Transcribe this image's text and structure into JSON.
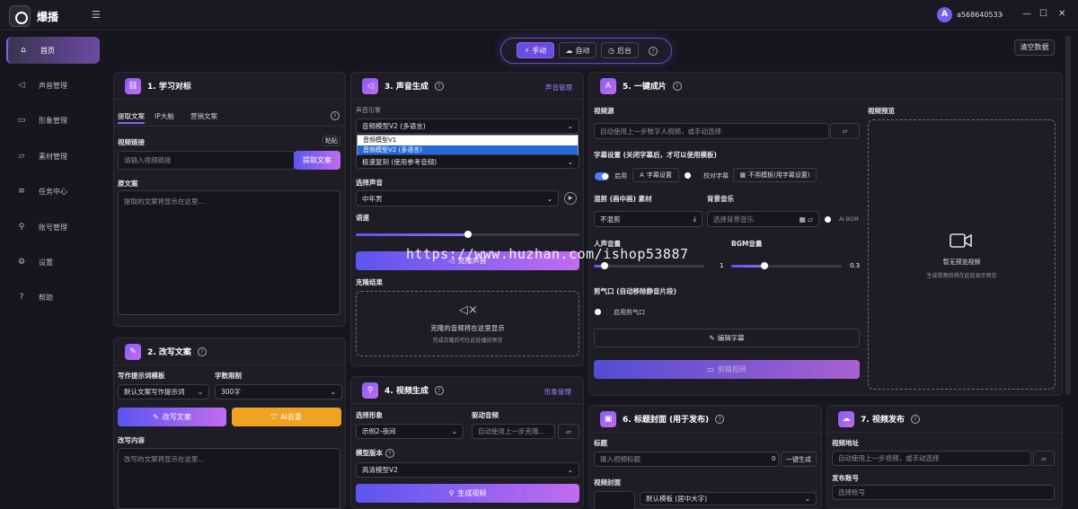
{
  "app": {
    "name": "爆播",
    "user": "a568640533",
    "avatar_letter": "A"
  },
  "window": {
    "min": "—",
    "max": "☐",
    "close": "✕"
  },
  "sidebar": {
    "items": [
      {
        "label": "首页",
        "icon": "home-icon"
      },
      {
        "label": "声音管理",
        "icon": "speaker-icon"
      },
      {
        "label": "形象管理",
        "icon": "video-icon"
      },
      {
        "label": "素材管理",
        "icon": "folder-icon"
      },
      {
        "label": "任务中心",
        "icon": "list-icon"
      },
      {
        "label": "账号管理",
        "icon": "user-icon"
      },
      {
        "label": "设置",
        "icon": "gear-icon"
      },
      {
        "label": "帮助",
        "icon": "help-icon"
      }
    ]
  },
  "modes": {
    "manual": "手动",
    "auto": "自动",
    "background": "后台"
  },
  "clear_button": "清空数据",
  "p1": {
    "title": "1. 学习对标",
    "tabs": [
      "提取文案",
      "IP大脑",
      "营销文案"
    ],
    "video_link_label": "视频链接",
    "paste": "粘贴",
    "link_placeholder": "请输入视频链接",
    "extract_button": "提取文案",
    "source_label": "原文案",
    "source_placeholder": "提取的文案将显示在这里..."
  },
  "p2": {
    "title": "2. 改写文案",
    "template_label": "写作提示词模板",
    "template_value": "默认文案写作提示词",
    "limit_label": "字数限制",
    "limit_value": "300字",
    "rewrite_button": "改写文案",
    "ai_button": "AI去重",
    "content_label": "改写内容",
    "content_placeholder": "改写的文案将显示在这里..."
  },
  "p3": {
    "title": "3. 声音生成",
    "manage": "声音管理",
    "engine_label": "声音引擎",
    "engine_value": "音频模型V2 (多语言)",
    "engine_options": [
      "音频模型V1",
      "音频模型V2 (多语言)"
    ],
    "fast_clone": "极速复刻 (使用参考音频)",
    "voice_label": "选择声音",
    "voice_value": "中年男",
    "speed_label": "语速",
    "clone_button": "克隆声音",
    "result_label": "克隆结果",
    "result_text": "克隆的音频将在这里显示",
    "result_sub": "完成克隆后可在此处播放预览"
  },
  "p4": {
    "title": "4. 视频生成",
    "manage": "形象管理",
    "avatar_label": "选择形象",
    "avatar_value": "示例2-夜间",
    "audio_label": "驱动音频",
    "audio_placeholder": "自动使用上一步克隆...",
    "model_label": "模型版本",
    "model_value": "高清模型V2",
    "generate_button": "生成视频"
  },
  "p5": {
    "title": "5. 一键成片",
    "video_src_label": "视频源",
    "video_src_placeholder": "自动使用上一步数字人视频，或手动选择",
    "subtitle_label": "字幕设置 (关闭字幕后，才可以使用模板)",
    "enable": "启用",
    "subtitle_settings": "字幕设置",
    "proofread": "校对字幕",
    "no_template": "不用模板(用字幕设置)",
    "pip_label": "混剪 (画中画) 素材",
    "pip_value": "不混剪",
    "bgm_label": "背景音乐",
    "bgm_placeholder": "选择背景音乐",
    "ai_bgm": "AI BGM",
    "voice_vol_label": "人声音量",
    "voice_vol": "1",
    "bgm_vol_label": "BGM音量",
    "bgm_vol": "0.3",
    "cut_label": "剪气口 (自动移除静音片段)",
    "cut_enable": "启用剪气口",
    "edit_subtitle": "编辑字幕",
    "edit_video": "剪辑视频",
    "preview_label": "视频预览",
    "preview_empty": "暂无预览视频",
    "preview_sub": "生成视频后将在此处显示预览"
  },
  "p6": {
    "title": "6. 标题封面 (用于发布)",
    "title_label": "标题",
    "title_placeholder": "输入视频标题",
    "count": "0",
    "gen_button": "一键生成",
    "cover_label": "视频封面",
    "cover_template": "默认模板 (居中大字)"
  },
  "p7": {
    "title": "7. 视频发布",
    "addr_label": "视频地址",
    "addr_placeholder": "自动使用上一步视频，或手动选择",
    "account_label": "发布账号",
    "account_placeholder": "选择账号"
  },
  "watermark": "https://www.huzhan.com/ishop53887",
  "colors": {
    "accent": "#8a5cf5",
    "button_gradient_start": "#5b55f0",
    "button_gradient_end": "#c16cf0",
    "orange": "#f0a320"
  },
  "progress": {
    "speech_speed": 0.5,
    "voice_volume": 0.1,
    "bgm_volume": 0.3
  }
}
